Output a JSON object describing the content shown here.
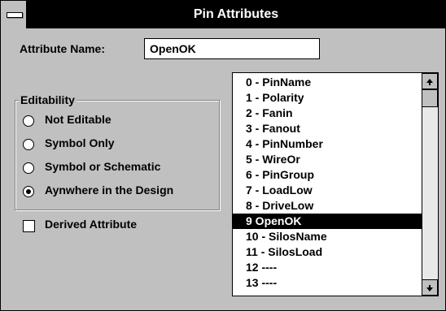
{
  "window": {
    "title": "Pin Attributes"
  },
  "attribute_name": {
    "label": "Attribute Name:",
    "value": "OpenOK"
  },
  "editability": {
    "label": "Editability",
    "options": [
      {
        "label": "Not Editable",
        "selected": false
      },
      {
        "label": "Symbol Only",
        "selected": false
      },
      {
        "label": "Symbol or Schematic",
        "selected": false
      },
      {
        "label": "Aynwhere in the Design",
        "selected": true
      }
    ]
  },
  "derived_attribute": {
    "label": "Derived Attribute",
    "checked": false
  },
  "attribute_list": {
    "items": [
      "0 - PinName",
      "1 - Polarity",
      "2 - Fanin",
      "3 - Fanout",
      "4 - PinNumber",
      "5 - WireOr",
      "6 - PinGroup",
      "7 - LoadLow",
      "8 - DriveLow",
      "9  OpenOK",
      "10 - SilosName",
      "11 - SilosLoad",
      "12   ----",
      "13   ----"
    ],
    "selected_index": 9
  },
  "icons": {
    "system_menu": "system-menu-icon",
    "scroll_up": "up-arrow-icon",
    "scroll_down": "down-arrow-icon"
  },
  "colors": {
    "titlebar": "#000000",
    "dialog": "#c0c0c0",
    "selection": "#000000"
  }
}
